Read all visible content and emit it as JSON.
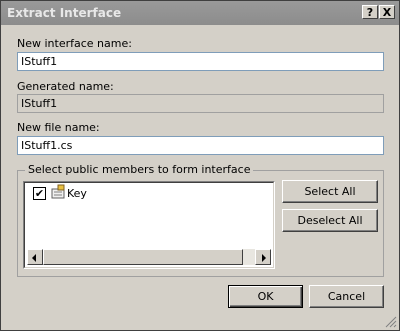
{
  "window": {
    "title": "Extract Interface",
    "help_label": "?",
    "close_label": "X"
  },
  "fields": {
    "interface_name": {
      "label": "New interface name:",
      "value": "IStuff1"
    },
    "generated_name": {
      "label": "Generated name:",
      "value": "IStuff1"
    },
    "file_name": {
      "label": "New file name:",
      "value": "IStuff1.cs"
    }
  },
  "members": {
    "group_label": "Select public members to form interface",
    "items": [
      {
        "label": "Key",
        "checked": true,
        "icon": "property-icon"
      }
    ]
  },
  "buttons": {
    "select_all": "Select All",
    "deselect_all": "Deselect All",
    "ok": "OK",
    "cancel": "Cancel"
  }
}
